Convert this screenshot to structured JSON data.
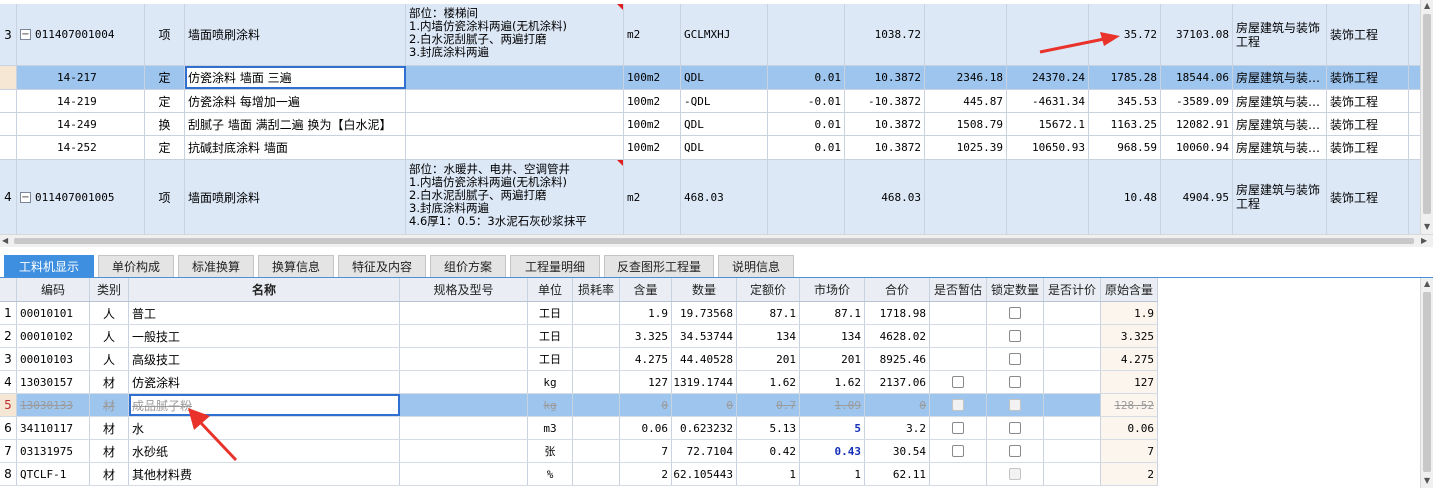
{
  "top_rows": [
    {
      "no": "3",
      "code": "011407001004",
      "type": "项",
      "name": "墙面喷刷涂料",
      "desc": "部位：楼梯间\n1.内墙仿瓷涂料两遍(无机涂料)\n2.白水泥刮腻子、两遍打磨\n3.封底涂料两遍",
      "unit": "m2",
      "expr": "GCLMXHJ",
      "qty": "",
      "amount": "1038.72",
      "price": "",
      "total": "",
      "c11": "35.72",
      "c12": "37103.08",
      "prof": "房屋建筑与装饰工程",
      "cat": "装饰工程"
    },
    {
      "no": "",
      "code": "14-217",
      "type": "定",
      "name": "仿瓷涂料 墙面 三遍",
      "desc": "",
      "unit": "100m2",
      "expr": "QDL",
      "qty": "0.01",
      "amount": "10.3872",
      "price": "2346.18",
      "total": "24370.24",
      "c11": "1785.28",
      "c12": "18544.06",
      "prof": "房屋建筑与装…",
      "cat": "装饰工程"
    },
    {
      "no": "",
      "code": "14-219",
      "type": "定",
      "name": "仿瓷涂料 每增加一遍",
      "desc": "",
      "unit": "100m2",
      "expr": "-QDL",
      "qty": "-0.01",
      "amount": "-10.3872",
      "price": "445.87",
      "total": "-4631.34",
      "c11": "345.53",
      "c12": "-3589.09",
      "prof": "房屋建筑与装…",
      "cat": "装饰工程"
    },
    {
      "no": "",
      "code": "14-249",
      "type": "换",
      "name": "刮腻子 墙面 满刮二遍   换为【白水泥】",
      "desc": "",
      "unit": "100m2",
      "expr": "QDL",
      "qty": "0.01",
      "amount": "10.3872",
      "price": "1508.79",
      "total": "15672.1",
      "c11": "1163.25",
      "c12": "12082.91",
      "prof": "房屋建筑与装…",
      "cat": "装饰工程"
    },
    {
      "no": "",
      "code": "14-252",
      "type": "定",
      "name": "抗碱封底涂料 墙面",
      "desc": "",
      "unit": "100m2",
      "expr": "QDL",
      "qty": "0.01",
      "amount": "10.3872",
      "price": "1025.39",
      "total": "10650.93",
      "c11": "968.59",
      "c12": "10060.94",
      "prof": "房屋建筑与装…",
      "cat": "装饰工程"
    },
    {
      "no": "4",
      "code": "011407001005",
      "type": "项",
      "name": "墙面喷刷涂料",
      "desc": "部位：水暖井、电井、空调管井\n1.内墙仿瓷涂料两遍(无机涂料)\n2.白水泥刮腻子、两遍打磨\n3.封底涂料两遍\n4.6厚1：0.5：3水泥石灰砂浆抹平",
      "unit": "m2",
      "expr": "468.03",
      "qty": "",
      "amount": "468.03",
      "price": "",
      "total": "",
      "c11": "10.48",
      "c12": "4904.95",
      "prof": "房屋建筑与装饰工程",
      "cat": "装饰工程"
    }
  ],
  "tabs": [
    "工料机显示",
    "单价构成",
    "标准换算",
    "换算信息",
    "特征及内容",
    "组价方案",
    "工程量明细",
    "反查图形工程量",
    "说明信息"
  ],
  "bottom_headers": [
    "编码",
    "类别",
    "名称",
    "规格及型号",
    "单位",
    "损耗率",
    "含量",
    "数量",
    "定额价",
    "市场价",
    "合价",
    "是否暂估",
    "锁定数量",
    "是否计价",
    "原始含量"
  ],
  "bottom_rows": [
    {
      "no": "1",
      "code": "00010101",
      "cat": "人",
      "name": "普工",
      "spec": "",
      "unit": "工日",
      "loss": "",
      "content": "1.9",
      "qty": "19.73568",
      "base": "87.1",
      "market": "87.1",
      "total": "1718.98",
      "orig": "1.9"
    },
    {
      "no": "2",
      "code": "00010102",
      "cat": "人",
      "name": "一般技工",
      "spec": "",
      "unit": "工日",
      "loss": "",
      "content": "3.325",
      "qty": "34.53744",
      "base": "134",
      "market": "134",
      "total": "4628.02",
      "orig": "3.325"
    },
    {
      "no": "3",
      "code": "00010103",
      "cat": "人",
      "name": "高级技工",
      "spec": "",
      "unit": "工日",
      "loss": "",
      "content": "4.275",
      "qty": "44.40528",
      "base": "201",
      "market": "201",
      "total": "8925.46",
      "orig": "4.275"
    },
    {
      "no": "4",
      "code": "13030157",
      "cat": "材",
      "name": "仿瓷涂料",
      "spec": "",
      "unit": "kg",
      "loss": "",
      "content": "127",
      "qty": "1319.1744",
      "base": "1.62",
      "market": "1.62",
      "total": "2137.06",
      "orig": "127"
    },
    {
      "no": "5",
      "code": "13030133",
      "cat": "材",
      "name": "成品腻子粉",
      "spec": "",
      "unit": "kg",
      "loss": "",
      "content": "0",
      "qty": "0",
      "base": "0.7",
      "market": "1.09",
      "total": "0",
      "orig": "128.52"
    },
    {
      "no": "6",
      "code": "34110117",
      "cat": "材",
      "name": "水",
      "spec": "",
      "unit": "m3",
      "loss": "",
      "content": "0.06",
      "qty": "0.623232",
      "base": "5.13",
      "market": "5",
      "total": "3.2",
      "orig": "0.06"
    },
    {
      "no": "7",
      "code": "03131975",
      "cat": "材",
      "name": "水砂纸",
      "spec": "",
      "unit": "张",
      "loss": "",
      "content": "7",
      "qty": "72.7104",
      "base": "0.42",
      "market": "0.43",
      "total": "30.54",
      "orig": "7"
    },
    {
      "no": "8",
      "code": "QTCLF-1",
      "cat": "材",
      "name": "其他材料费",
      "spec": "",
      "unit": "%",
      "loss": "",
      "content": "2",
      "qty": "62.105443",
      "base": "1",
      "market": "1",
      "total": "62.11",
      "orig": "2"
    }
  ],
  "colors": {
    "accent": "#3f8fe0",
    "selected_row": "#9ec5ee",
    "parent_row": "#dde8f7",
    "annotation": "#e8322a"
  }
}
